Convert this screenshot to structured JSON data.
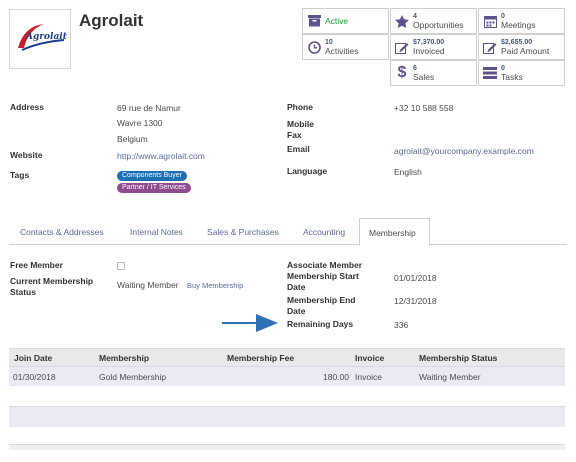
{
  "record": {
    "name": "Agrolait",
    "logo_text": "Agrolait"
  },
  "smart_buttons": {
    "active": {
      "label": "Active",
      "icon": "archive-icon"
    },
    "opportunities": {
      "count": "4",
      "label": "Opportunities",
      "icon": "star-icon"
    },
    "meetings": {
      "count": "0",
      "label": "Meetings",
      "icon": "calendar-icon"
    },
    "activities": {
      "count": "10",
      "label": "Activities",
      "icon": "clock-icon"
    },
    "invoiced": {
      "amount": "$7,370.00",
      "label": "Invoiced",
      "icon": "edit-icon"
    },
    "paid": {
      "amount": "$2,655.00",
      "label": "Paid Amount",
      "icon": "edit-icon"
    },
    "sales": {
      "count": "6",
      "label": "Sales",
      "icon": "dollar-icon"
    },
    "tasks": {
      "count": "0",
      "label": "Tasks",
      "icon": "tasks-icon"
    }
  },
  "info": {
    "address_label": "Address",
    "address_line1": "69 rue de Namur",
    "address_line2": "Wavre 1300",
    "address_line3": "Belgium",
    "website_label": "Website",
    "website": "http://www.agrolait.com",
    "tags_label": "Tags",
    "tags": [
      {
        "label": "Components Buyer",
        "color": "#1a6fb5"
      },
      {
        "label": "Partner / IT Services",
        "color": "#8e4b8e"
      }
    ],
    "phone_label": "Phone",
    "phone": "+32 10 588 558",
    "mobile_label": "Mobile",
    "fax_label": "Fax",
    "email_label": "Email",
    "email": "agrolait@yourcompany.example.com",
    "language_label": "Language",
    "language": "English"
  },
  "tabs": [
    {
      "label": "Contacts & Addresses"
    },
    {
      "label": "Internal Notes"
    },
    {
      "label": "Sales & Purchases"
    },
    {
      "label": "Accounting"
    },
    {
      "label": "Membership",
      "active": true
    }
  ],
  "membership": {
    "free_member_label": "Free Member",
    "free_member_checked": false,
    "current_status_label_1": "Current Membership",
    "current_status_label_2": "Status",
    "current_status": "Waiting Member",
    "buy_link": "Buy Membership",
    "associate_label": "Associate Member",
    "start_label_1": "Membership Start",
    "start_label_2": "Date",
    "start_date": "01/01/2018",
    "end_label_1": "Membership End",
    "end_label_2": "Date",
    "end_date": "12/31/2018",
    "remaining_label": "Remaining Days",
    "remaining_days": "336"
  },
  "grid": {
    "columns": [
      "Join Date",
      "Membership",
      "Membership Fee",
      "Invoice",
      "Membership Status"
    ],
    "rows": [
      {
        "join_date": "01/30/2018",
        "membership": "Gold Membership",
        "fee": "180.00",
        "invoice": "Invoice",
        "status": "Waiting Member"
      }
    ]
  },
  "colors": {
    "active_green": "#13a02d",
    "link_blue": "#5b6a9e",
    "icon_purple": "#5f5190",
    "arrow_blue": "#2f6fb5"
  }
}
